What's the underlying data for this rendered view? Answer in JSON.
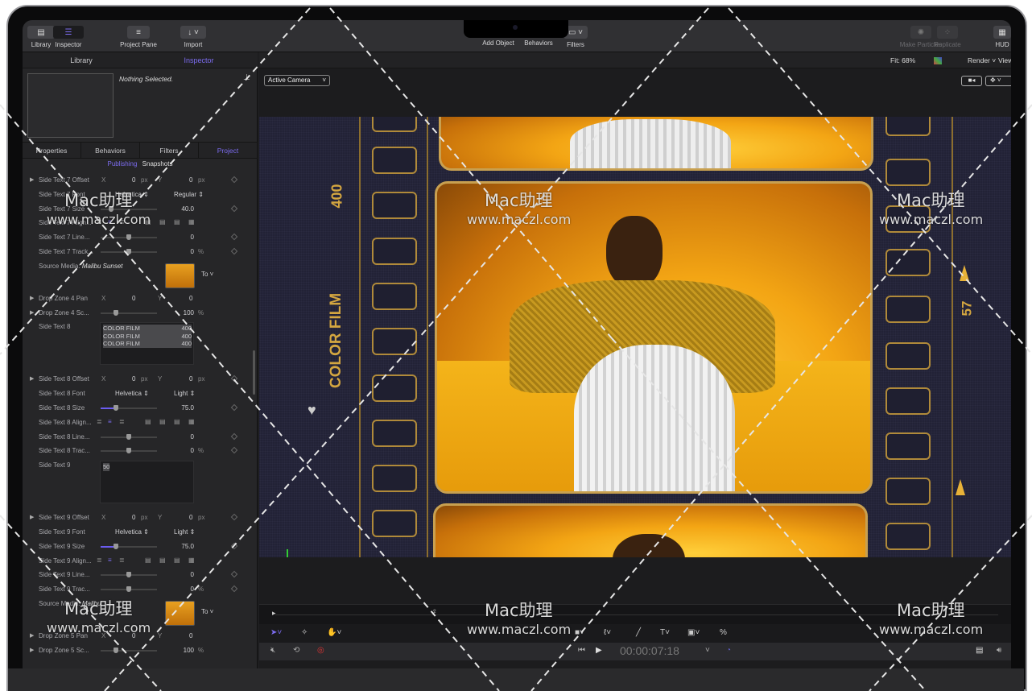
{
  "toolbar": {
    "library": "Library",
    "inspector": "Inspector",
    "project_pane": "Project Pane",
    "import": "Import",
    "add_object": "Add Object",
    "behaviors": "Behaviors",
    "filters": "Filters",
    "make_particles": "Make Particles",
    "replicate": "Replicate",
    "hud": "HUD"
  },
  "left": {
    "tabs": [
      "Library",
      "Inspector"
    ],
    "nothing_selected": "Nothing Selected.",
    "subtabs": [
      "Properties",
      "Behaviors",
      "Filters",
      "Project"
    ],
    "publishing": "Publishing",
    "snapshots": "Snapshots",
    "rows": [
      {
        "type": "xy",
        "arrow": true,
        "label": "Side Text 7 Offset",
        "x": "0",
        "y": "0",
        "unit": "px",
        "key": true
      },
      {
        "type": "font",
        "label": "Side Text 7 Font",
        "font": "Helvetica",
        "style": "Regular"
      },
      {
        "type": "slider",
        "label": "Side Text 7 Size",
        "value": "40.0",
        "pos": 0.15,
        "key": true
      },
      {
        "type": "align",
        "label": "Side Text 7 Align..."
      },
      {
        "type": "slider",
        "label": "Side Text 7 Line...",
        "value": "0",
        "pos": 0.5,
        "key": true
      },
      {
        "type": "slider",
        "label": "Side Text 7 Track...",
        "value": "0",
        "unit": "%",
        "pos": 0.5,
        "key": true
      },
      {
        "type": "media",
        "label": "Source Media:",
        "name": "Malibu Sunset",
        "to": "To"
      },
      {
        "type": "xy",
        "arrow": true,
        "label": "Drop Zone 4 Pan",
        "x": "0",
        "y": "0",
        "unit": ""
      },
      {
        "type": "slider",
        "arrow": true,
        "label": "Drop Zone 4 Sc...",
        "value": "100",
        "unit": "%",
        "pos": 0.25
      },
      {
        "type": "text",
        "label": "Side Text 8",
        "lines": [
          [
            "COLOR FILM",
            "400"
          ],
          [
            "COLOR FILM",
            "400"
          ],
          [
            "COLOR FILM",
            "400"
          ]
        ]
      },
      {
        "type": "xy",
        "arrow": true,
        "label": "Side Text 8 Offset",
        "x": "0",
        "y": "0",
        "unit": "px",
        "key": true
      },
      {
        "type": "font",
        "label": "Side Text 8 Font",
        "font": "Helvetica",
        "style": "Light"
      },
      {
        "type": "slider",
        "label": "Side Text 8 Size",
        "value": "75.0",
        "pos": 0.25,
        "fill": true,
        "key": true
      },
      {
        "type": "align",
        "label": "Side Text 8 Align..."
      },
      {
        "type": "slider",
        "label": "Side Text 8 Line...",
        "value": "0",
        "pos": 0.5,
        "key": true
      },
      {
        "type": "slider",
        "label": "Side Text 8 Trac...",
        "value": "0",
        "unit": "%",
        "pos": 0.5,
        "key": true
      },
      {
        "type": "text",
        "label": "Side Text 9",
        "lines": [
          [
            "50",
            ""
          ]
        ]
      },
      {
        "type": "xy",
        "arrow": true,
        "label": "Side Text 9 Offset",
        "x": "0",
        "y": "0",
        "unit": "px",
        "key": true
      },
      {
        "type": "font",
        "label": "Side Text 9 Font",
        "font": "Helvetica",
        "style": "Light"
      },
      {
        "type": "slider",
        "label": "Side Text 9 Size",
        "value": "75.0",
        "pos": 0.25,
        "fill": true,
        "key": true
      },
      {
        "type": "align",
        "label": "Side Text 9 Align..."
      },
      {
        "type": "slider",
        "label": "Side Text 9 Line...",
        "value": "0",
        "pos": 0.5,
        "key": true
      },
      {
        "type": "slider",
        "label": "Side Text 9 Trac...",
        "value": "0",
        "unit": "%",
        "pos": 0.5,
        "key": true
      },
      {
        "type": "media",
        "label": "Source Media:",
        "name": "Malibu",
        "to": "To"
      },
      {
        "type": "xy",
        "arrow": true,
        "label": "Drop Zone 5 Pan",
        "x": "0",
        "y": "0",
        "unit": ""
      },
      {
        "type": "slider",
        "arrow": true,
        "label": "Drop Zone 5 Sc...",
        "value": "100",
        "unit": "%",
        "pos": 0.25
      }
    ]
  },
  "viewer": {
    "fit": "Fit: 68%",
    "render": "Render",
    "view": "View",
    "camera": "Active Camera",
    "film_text": {
      "iso": "400",
      "brand": "COLOR FILM",
      "frame_no": "57"
    },
    "timecode": "00:00:07:18"
  },
  "watermark": {
    "title": "Mac助理",
    "url": "www.maczl.com"
  },
  "colors": {
    "accent": "#7c6cf0",
    "film_gold": "#c8a050",
    "canvas_bg": "#222236"
  }
}
